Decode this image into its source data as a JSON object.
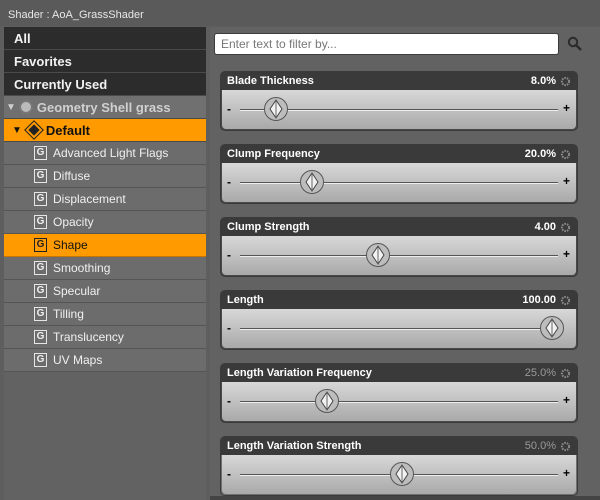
{
  "window": {
    "title": "Shader : AoA_GrassShader"
  },
  "sidebar": {
    "top_items": [
      {
        "label": "All"
      },
      {
        "label": "Favorites"
      },
      {
        "label": "Currently Used"
      }
    ],
    "group": {
      "label": "Geometry Shell grass",
      "expanded": true
    },
    "subgroup": {
      "label": "Default",
      "expanded": true
    },
    "items": [
      {
        "label": "Advanced Light Flags",
        "icon": "G"
      },
      {
        "label": "Diffuse",
        "icon": "G"
      },
      {
        "label": "Displacement",
        "icon": "G"
      },
      {
        "label": "Opacity",
        "icon": "G"
      },
      {
        "label": "Shape",
        "icon": "G",
        "active": true
      },
      {
        "label": "Smoothing",
        "icon": "G"
      },
      {
        "label": "Specular",
        "icon": "G"
      },
      {
        "label": "Tilling",
        "icon": "G"
      },
      {
        "label": "Translucency",
        "icon": "G"
      },
      {
        "label": "UV Maps",
        "icon": "G"
      }
    ]
  },
  "search": {
    "placeholder": "Enter text to filter by...",
    "value": ""
  },
  "properties": [
    {
      "label": "Blade Thickness",
      "value": "8.0%",
      "fraction": 0.08,
      "dim": false
    },
    {
      "label": "Clump Frequency",
      "value": "20.0%",
      "fraction": 0.2,
      "dim": false
    },
    {
      "label": "Clump Strength",
      "value": "4.00",
      "fraction": 0.42,
      "dim": false
    },
    {
      "label": "Length",
      "value": "100.00",
      "fraction": 1.0,
      "dim": false
    },
    {
      "label": "Length Variation Frequency",
      "value": "25.0%",
      "fraction": 0.25,
      "dim": true
    },
    {
      "label": "Length Variation Strength",
      "value": "50.0%",
      "fraction": 0.5,
      "dim": true
    }
  ],
  "slider_symbols": {
    "minus": "-",
    "plus": "+"
  },
  "colors": {
    "selection": "#ff9a00",
    "panel": "#626262",
    "header": "#2c2c2c"
  }
}
